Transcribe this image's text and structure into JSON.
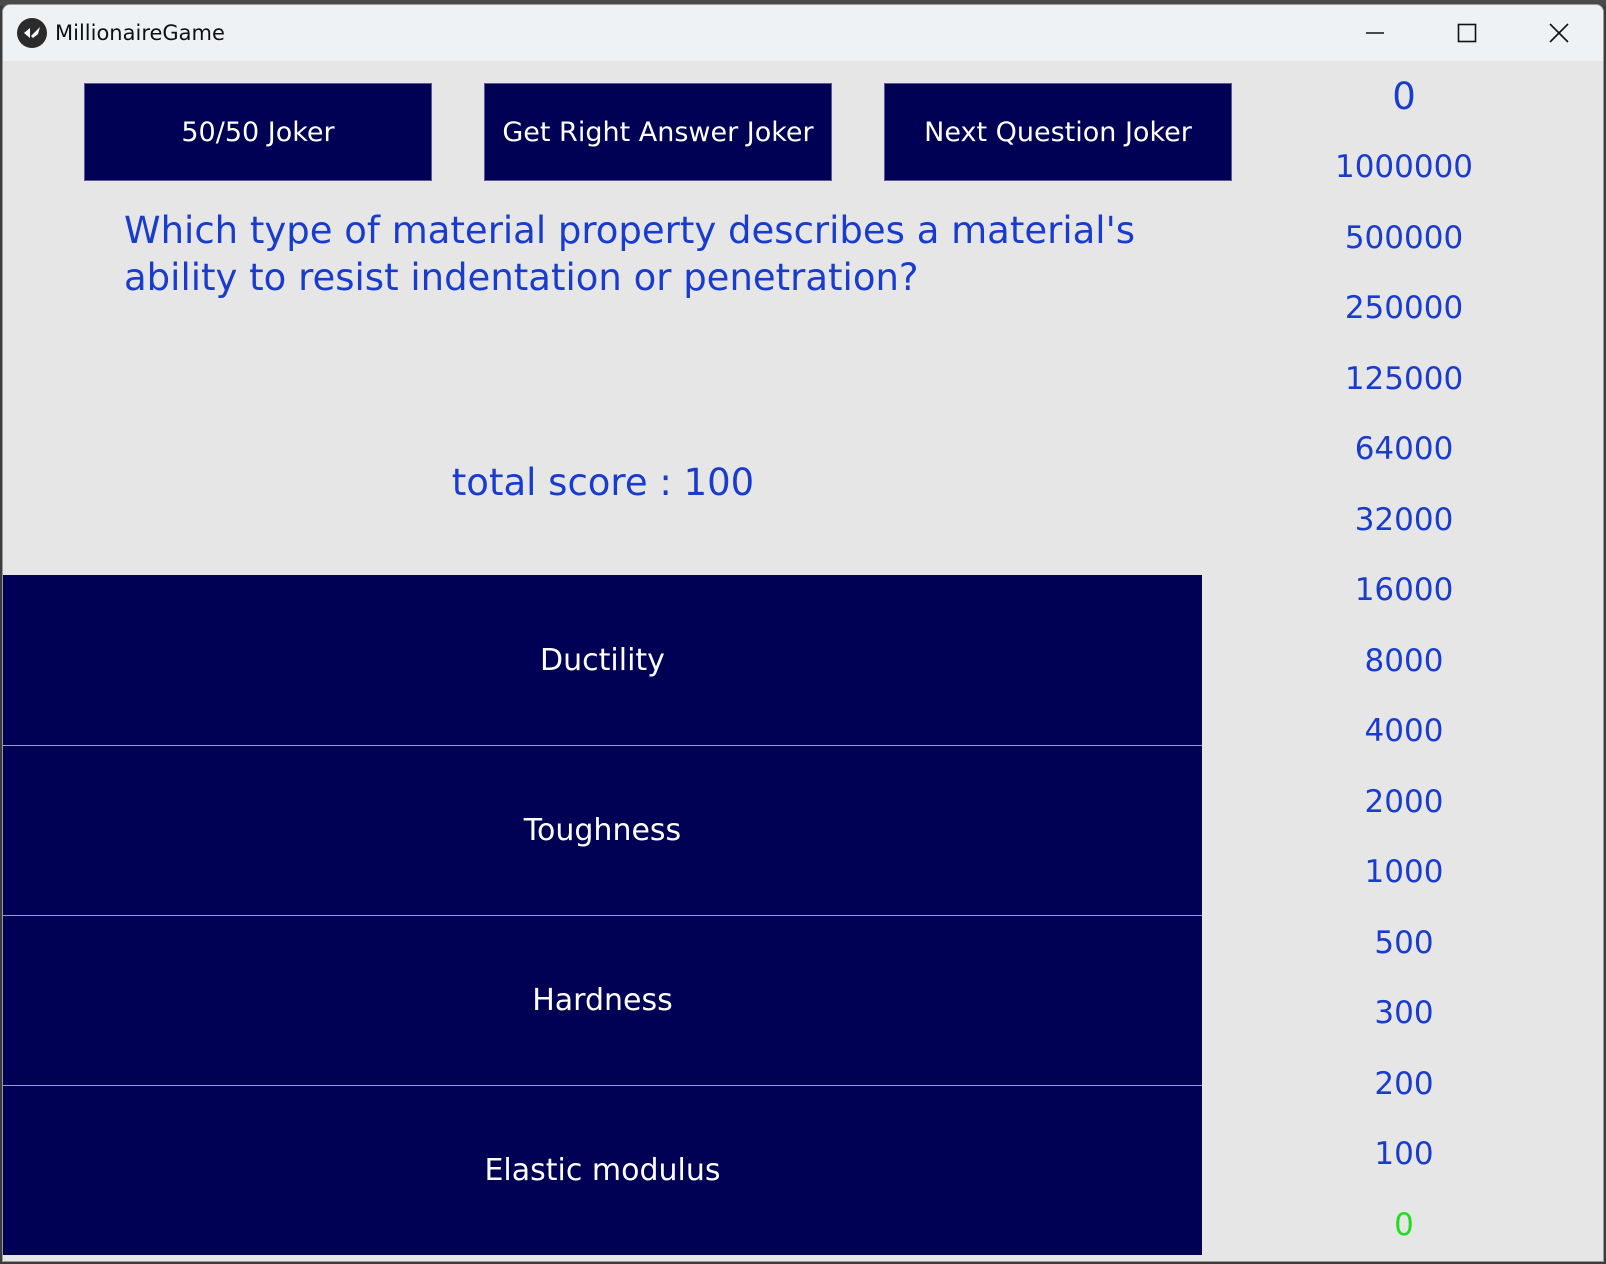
{
  "window": {
    "title": "MillionaireGame",
    "icon": "kivy-icon",
    "controls": [
      "minimize-icon",
      "maximize-icon",
      "close-icon"
    ]
  },
  "jokers": {
    "fifty_fifty": "50/50 Joker",
    "right_answer": "Get Right Answer Joker",
    "next_question": "Next Question Joker"
  },
  "question": "Which type of material property describes a material's ability to resist indentation or penetration?",
  "total_score": "total score : 100",
  "answers": [
    "Ductility",
    "Toughness",
    "Hardness",
    "Elastic modulus"
  ],
  "prize_ladder": {
    "current_prize": "0",
    "levels": [
      "1000000",
      "500000",
      "250000",
      "125000",
      "64000",
      "32000",
      "16000",
      "8000",
      "4000",
      "2000",
      "1000",
      "500",
      "300",
      "200",
      "100",
      "0"
    ],
    "current_level_color": "#22dd22"
  },
  "colors": {
    "button_bg": "#000055",
    "text_blue": "#1a3ccc",
    "background": "#e6e6e6"
  }
}
